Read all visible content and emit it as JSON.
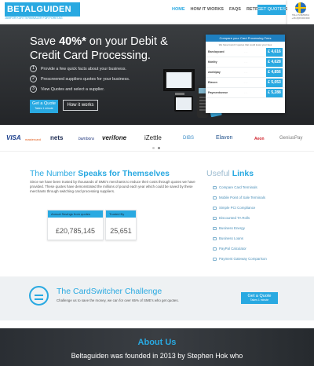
{
  "header": {
    "logo": "BETALGUIDEN",
    "logo_sub": "JÄMFÖR KORTTERMINALER FÖR FÖRETAG",
    "nav": [
      "HOME",
      "HOW IT WORKS",
      "FAQS",
      "RETRIEVE QUOTES"
    ],
    "cta": "GET QUOTES",
    "flag_line1": "TALA SVENSKA",
    "flag_line2": "+46 (0)8 000 000",
    "accent": "#29a9e1"
  },
  "hero": {
    "title_pre": "Save ",
    "title_bold": "40%*",
    "title_post": " on your Debit & Credit Card Processing.",
    "steps": [
      {
        "num": "1",
        "text": "Provide a few quick facts about your business."
      },
      {
        "num": "2",
        "text": "Prescreened suppliers quotes for your business."
      },
      {
        "num": "3",
        "text": "View Quotes and select a supplier."
      }
    ],
    "btn_quote": "Get a Quote",
    "btn_quote_sub": "Takes 1 minute",
    "btn_how": "How it works"
  },
  "comparison": {
    "title": "Compare your Card Processing Fees",
    "subtitle": "We have found 3 quotes that could lower your fees",
    "rows": [
      {
        "provider": "Barclaycard",
        "price": "£ 4,616"
      },
      {
        "provider": "fidelity",
        "price": "£ 4,628"
      },
      {
        "provider": "worldpay",
        "price": "£ 4,856"
      },
      {
        "provider": "Elavon",
        "price": "£ 5,053"
      },
      {
        "provider": "Paymentsense",
        "price": "£ 5,288"
      }
    ]
  },
  "partners": [
    "VISA",
    "mastercard",
    "nets",
    "bambora",
    "verifone",
    "iZettle",
    "DIBS",
    "Elavon",
    "Aeon",
    "GeniusPay"
  ],
  "numbers": {
    "title_pre": "The Number ",
    "title_bold": "Speaks for Themselves",
    "text": "Since we have been trusted by thousands of SME's merchants to reduce their costs through quotes we have provided. These quotes have demonstrated the millions of pound each year which could be saved by these merchants through switching card processing suppliers.",
    "stat1_label": "Annual Savings from quotes",
    "stat1_value": "£20,785,145",
    "stat2_label": "Trusted By",
    "stat2_value": "25,651"
  },
  "links": {
    "title_pre": "Useful ",
    "title_bold": "Links",
    "items": [
      "Compare Card Terminals",
      "Mobile Point of Sale Terminals",
      "Simple PCI Compliance",
      "Discounted TA Rolls",
      "Business Energy",
      "Business Loans",
      "PayPal Calculator",
      "Payment Gateway Comparison"
    ]
  },
  "challenge": {
    "title": "The CardSwitcher Challenge",
    "text": "Challenge us to save the money, we can for over 65% of SME's who get quotes.",
    "btn": "Get a Quote",
    "btn_sub": "Takes 1 minute"
  },
  "about": {
    "title": "About Us",
    "text": "Beltaguiden was founded in 2013 by Stephen Hok who"
  }
}
